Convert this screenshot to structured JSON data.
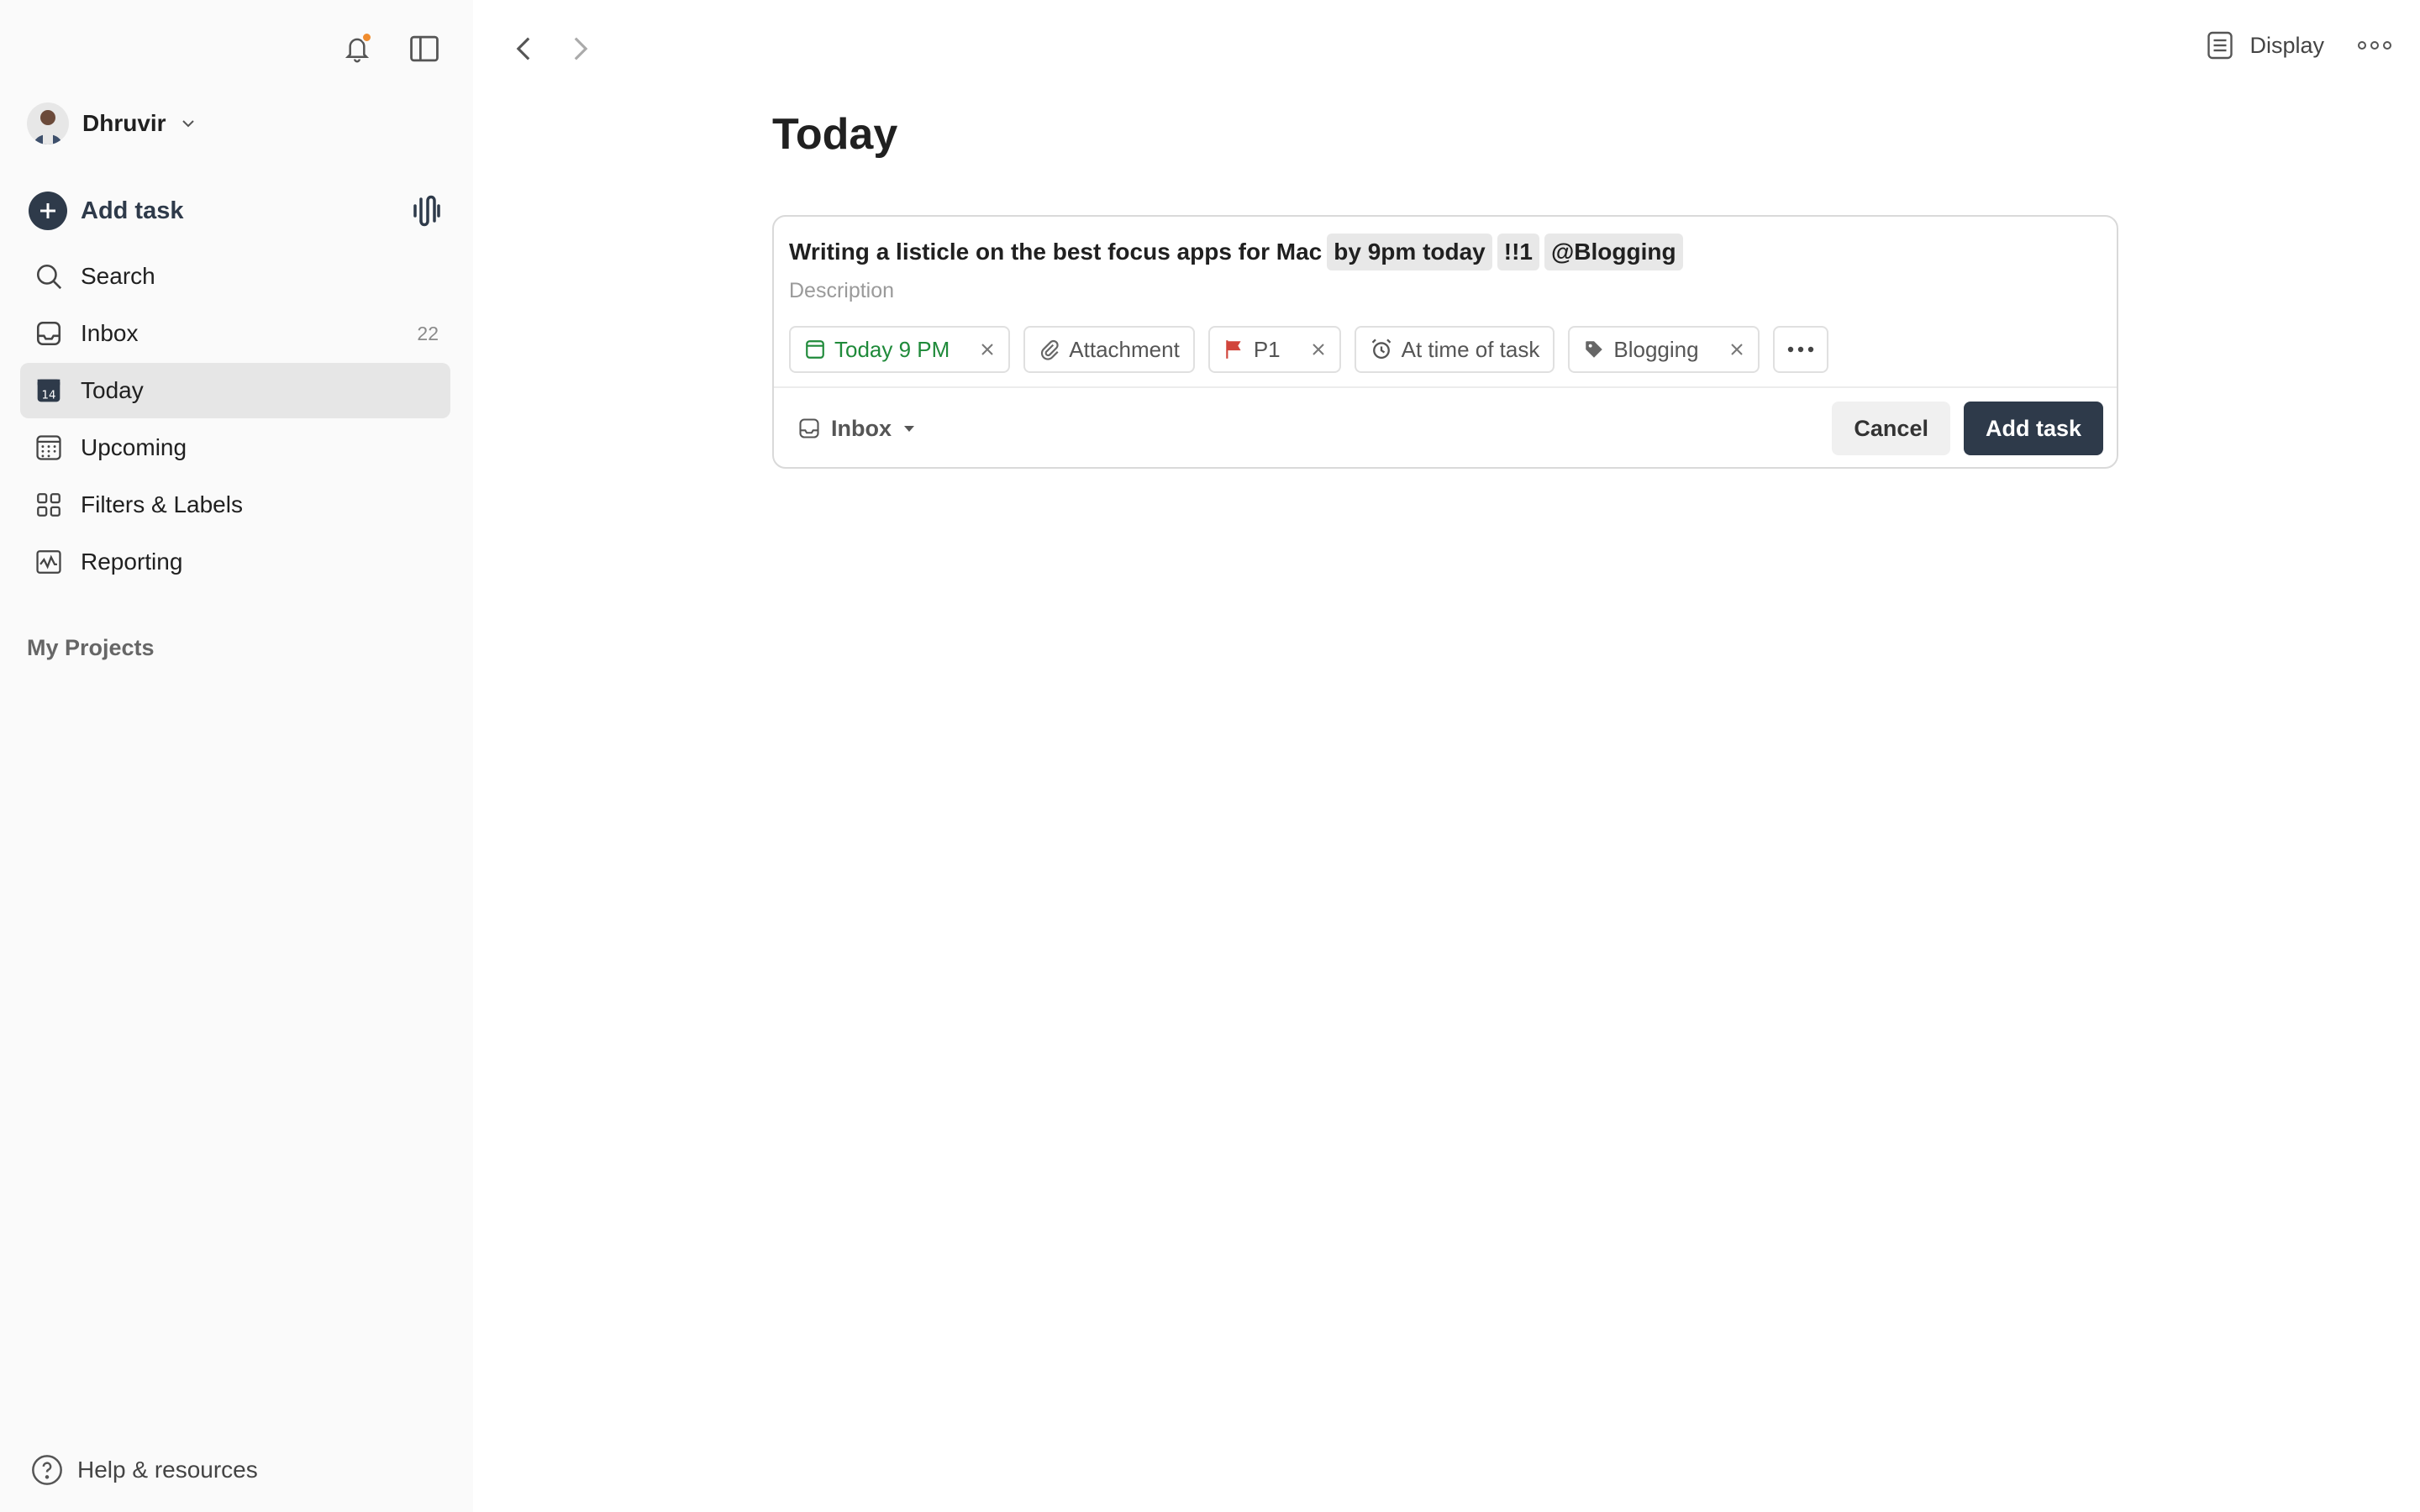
{
  "sidebar": {
    "user_name": "Dhruvir",
    "add_task_label": "Add task",
    "items": [
      {
        "label": "Search",
        "icon": "search-icon"
      },
      {
        "label": "Inbox",
        "icon": "inbox-icon",
        "count": "22"
      },
      {
        "label": "Today",
        "icon": "calendar-today-icon",
        "day": "14"
      },
      {
        "label": "Upcoming",
        "icon": "calendar-grid-icon"
      },
      {
        "label": "Filters & Labels",
        "icon": "grid-icon"
      },
      {
        "label": "Reporting",
        "icon": "chart-icon"
      }
    ],
    "section_title": "My Projects",
    "help_label": "Help & resources"
  },
  "header": {
    "display_label": "Display"
  },
  "main": {
    "title": "Today",
    "editor": {
      "task_text": "Writing a listicle on the best focus apps for Mac",
      "tokens": [
        "by 9pm today",
        "!!1",
        "@Blogging"
      ],
      "description_placeholder": "Description",
      "chips": {
        "date": "Today 9 PM",
        "attachment": "Attachment",
        "priority": "P1",
        "reminder": "At time of task",
        "label": "Blogging"
      },
      "project": "Inbox",
      "cancel_label": "Cancel",
      "submit_label": "Add task"
    }
  },
  "colors": {
    "accent": "#2e3a4a",
    "notification": "#f08c2e",
    "date_green": "#1f8a3a",
    "priority_red": "#d1453b"
  }
}
